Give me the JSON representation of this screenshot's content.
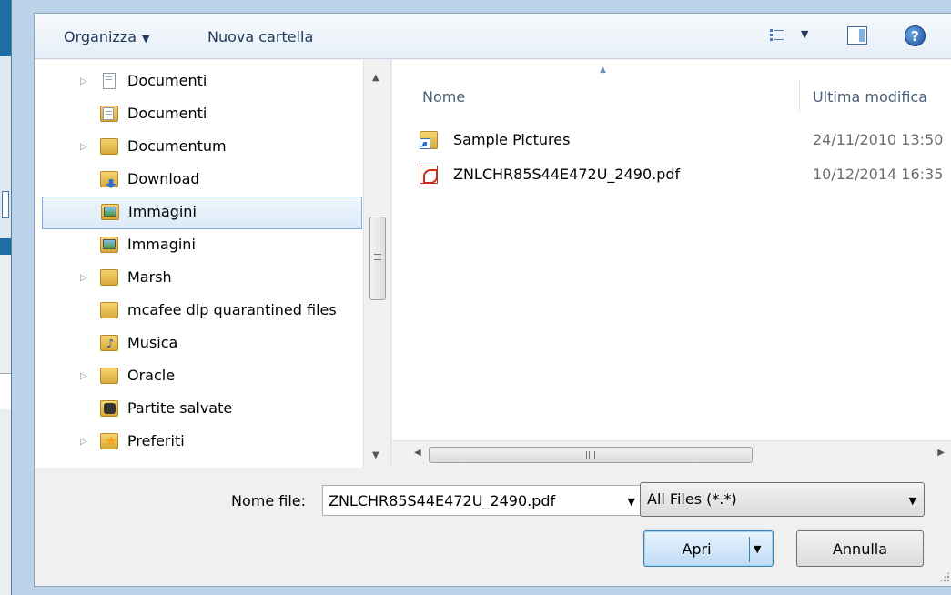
{
  "toolbar": {
    "organize_label": "Organizza",
    "new_folder_label": "Nuova cartella",
    "help_glyph": "?"
  },
  "nav": {
    "items": [
      {
        "label": "Documenti",
        "icon": "library-documents-icon",
        "expandable": true
      },
      {
        "label": "Documenti",
        "icon": "documents-folder-icon",
        "expandable": false
      },
      {
        "label": "Documentum",
        "icon": "folder-icon",
        "expandable": true
      },
      {
        "label": "Download",
        "icon": "downloads-folder-icon",
        "expandable": false
      },
      {
        "label": "Immagini",
        "icon": "pictures-folder-icon",
        "expandable": false,
        "selected": true
      },
      {
        "label": "Immagini",
        "icon": "pictures-folder-icon",
        "expandable": false
      },
      {
        "label": "Marsh",
        "icon": "folder-icon",
        "expandable": true
      },
      {
        "label": "mcafee dlp quarantined files",
        "icon": "folder-icon",
        "expandable": false
      },
      {
        "label": "Musica",
        "icon": "music-folder-icon",
        "expandable": false
      },
      {
        "label": "Oracle",
        "icon": "folder-icon",
        "expandable": true
      },
      {
        "label": "Partite salvate",
        "icon": "saved-games-folder-icon",
        "expandable": false
      },
      {
        "label": "Preferiti",
        "icon": "favorites-folder-icon",
        "expandable": true
      }
    ]
  },
  "files": {
    "columns": {
      "name": "Nome",
      "modified": "Ultima modifica"
    },
    "rows": [
      {
        "name": "Sample Pictures",
        "modified": "24/11/2010 13:50",
        "icon": "folder-shortcut-icon"
      },
      {
        "name": "ZNLCHR85S44E472U_2490.pdf",
        "modified": "10/12/2014 16:35",
        "icon": "pdf-file-icon"
      }
    ]
  },
  "footer": {
    "filename_label": "Nome file:",
    "filename_value": "ZNLCHR85S44E472U_2490.pdf",
    "filter_value": "All Files (*.*)",
    "open_label": "Apri",
    "cancel_label": "Annulla"
  }
}
